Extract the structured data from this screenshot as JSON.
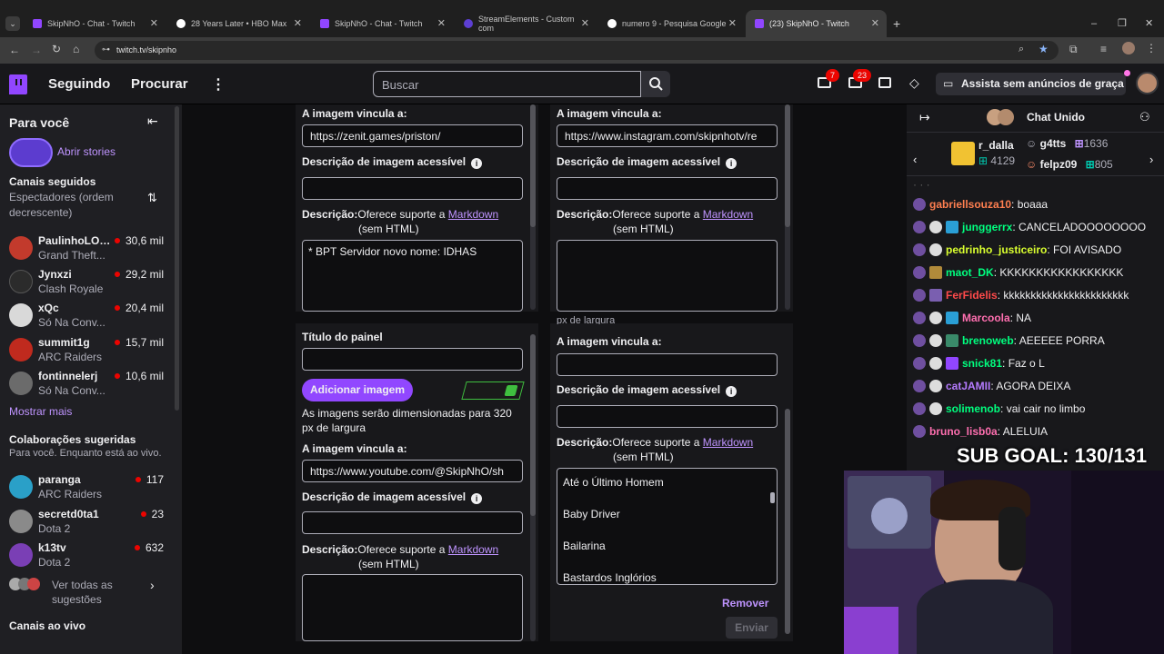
{
  "browser": {
    "tabs": [
      {
        "title": "SkipNhO - Chat - Twitch",
        "favicon_color": "#9146ff"
      },
      {
        "title": "28 Years Later • HBO Max",
        "favicon_color": "#ffffff"
      },
      {
        "title": "SkipNhO - Chat - Twitch",
        "favicon_color": "#9146ff"
      },
      {
        "title": "StreamElements - Custom com",
        "favicon_color": "#5d3fd3"
      },
      {
        "title": "numero 9 - Pesquisa Google",
        "favicon_color": "#ffffff"
      },
      {
        "title": "(23) SkipNhO - Twitch",
        "favicon_color": "#9146ff"
      }
    ],
    "url": "twitch.tv/skipnho"
  },
  "topnav": {
    "following": "Seguindo",
    "browse": "Procurar",
    "search_placeholder": "Buscar",
    "badge_prime": "7",
    "badge_inbox": "23",
    "ads_free": "Assista sem anúncios de graça"
  },
  "sidebar": {
    "for_you": "Para você",
    "stories": "Abrir stories",
    "followed_title": "Canais seguidos",
    "followed_sort": "Espectadores (ordem decrescente)",
    "followed": [
      {
        "name": "PaulinhoLOK...",
        "game": "Grand Theft...",
        "viewers": "30,6 mil",
        "color": "#c23a2c"
      },
      {
        "name": "Jynxzi",
        "game": "Clash Royale",
        "viewers": "29,2 mil",
        "color": "#2b2b2b"
      },
      {
        "name": "xQc",
        "game": "Só Na Conv...",
        "viewers": "20,4 mil",
        "color": "#d9d9d9"
      },
      {
        "name": "summit1g",
        "game": "ARC Raiders",
        "viewers": "15,7 mil",
        "color": "#c02a1e"
      },
      {
        "name": "fontinnelerj",
        "game": "Só Na Conv...",
        "viewers": "10,6 mil",
        "color": "#6b6b6b"
      }
    ],
    "show_more": "Mostrar mais",
    "suggested_title": "Colaborações sugeridas",
    "suggested_sub": "Para você. Enquanto está ao vivo.",
    "suggested": [
      {
        "name": "paranga",
        "game": "ARC Raiders",
        "viewers": "117",
        "color": "#2aa0c8"
      },
      {
        "name": "secretd0ta1",
        "game": "Dota 2",
        "viewers": "23",
        "color": "#8a8a8a"
      },
      {
        "name": "k13tv",
        "game": "Dota 2",
        "viewers": "632",
        "color": "#7a3fb5"
      }
    ],
    "see_all": "Ver todas as sugestões",
    "live_channels": "Canais ao vivo"
  },
  "panels": {
    "link_label": "A imagem vincula a:",
    "alt_label": "Descrição de imagem acessível",
    "desc_prefix": "Descrição:",
    "desc_mid": "Oferece suporte a",
    "desc_link": "Markdown",
    "desc_suffix": "(sem HTML)",
    "p1_link": "https://zenit.games/priston/",
    "p1_desc": "* BPT Servidor novo nome: IDHAS",
    "p2_link": "https://www.instagram.com/skipnhotv/re",
    "p3_title_label": "Título do painel",
    "p3_add_image": "Adicionar imagem",
    "p3_size_note": "As imagens serão dimensionadas para 320 px de largura",
    "p3_link": "https://www.youtube.com/@SkipNhO/sh",
    "p4_partial": "px de largura",
    "p4_list": [
      "Até o Último Homem",
      "Baby Driver",
      "Bailarina",
      "Bastardos Inglórios"
    ],
    "remove": "Remover",
    "submit": "Enviar"
  },
  "chat": {
    "title": "Chat Unido",
    "top1_name": "r_dalla",
    "top1_amount": "4129",
    "top2_name": "g4tts",
    "top2_amount": "1636",
    "top3_name": "felpz09",
    "top3_amount": "805",
    "messages": [
      {
        "user": "gabriellsouza10",
        "text": "boaaa",
        "color": "#ff7f50"
      },
      {
        "user": "junggerrx",
        "text": "CANCELADOOOOOOOO",
        "color": "#00ff7f"
      },
      {
        "user": "pedrinho_justiceiro",
        "text": "FOI AVISADO",
        "color": "#daff2f"
      },
      {
        "user": "maot_DK",
        "text": "KKKKKKKKKKKKKKKKK",
        "color": "#00ff7f"
      },
      {
        "user": "FerFidelis",
        "text": "kkkkkkkkkkkkkkkkkkkkkkk",
        "color": "#ff4a4a"
      },
      {
        "user": "Marcoola",
        "text": "NA",
        "color": "#ff6fb0"
      },
      {
        "user": "brenoweb",
        "text": "AEEEEE PORRA",
        "color": "#00ff7f"
      },
      {
        "user": "snick81",
        "text": "Faz o L",
        "color": "#00ff7f"
      },
      {
        "user": "catJAMII",
        "text": "AGORA DEIXA",
        "color": "#b57bff"
      },
      {
        "user": "solimenob",
        "text": "vai cair no limbo",
        "color": "#00ff7f"
      },
      {
        "user": "bruno_lisb0a",
        "text": "ALELUIA",
        "color": "#ff6fb0"
      }
    ],
    "sub_goal": "SUB GOAL: 130/131"
  }
}
